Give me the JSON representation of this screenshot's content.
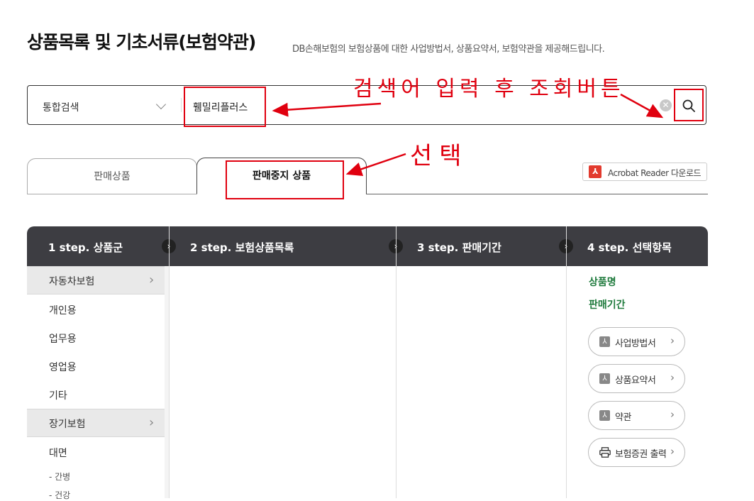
{
  "header": {
    "title": "상품목록 및 기초서류(보험약관)",
    "subtitle": "DB손해보험의 보험상품에 대한 사업방법서, 상품요약서, 보험약관을 제공해드립니다."
  },
  "search": {
    "type_selected": "통합검색",
    "value": "휌밀리플러스"
  },
  "tabs": {
    "on_sale": "판매상품",
    "discontinued": "판매중지 상품"
  },
  "acrobat": {
    "label": "Acrobat Reader 다운로드"
  },
  "steps": [
    "1 step. 상품군",
    "2 step. 보험상품목록",
    "3 step. 판매기간",
    "4 step. 선택항목"
  ],
  "categories": [
    {
      "label": "자동차보험",
      "items": [
        "개인용",
        "업무용",
        "영업용",
        "기타"
      ]
    },
    {
      "label": "장기보험",
      "items": [
        "대면"
      ],
      "subitems": [
        "- 간병",
        "- 건강"
      ]
    }
  ],
  "selection": {
    "product_name_label": "상품명",
    "sale_period_label": "판매기간",
    "buttons": [
      "사업방법서",
      "상품요약서",
      "약관",
      "보험증권 출력"
    ]
  },
  "annotations": {
    "search_hint": "검색어 입력 후 조회버튼",
    "select_hint": "선택"
  },
  "colors": {
    "step_header_bg": "#3d3d42",
    "selection_label": "#1e7a3c",
    "annotation_red": "#e0000f"
  }
}
